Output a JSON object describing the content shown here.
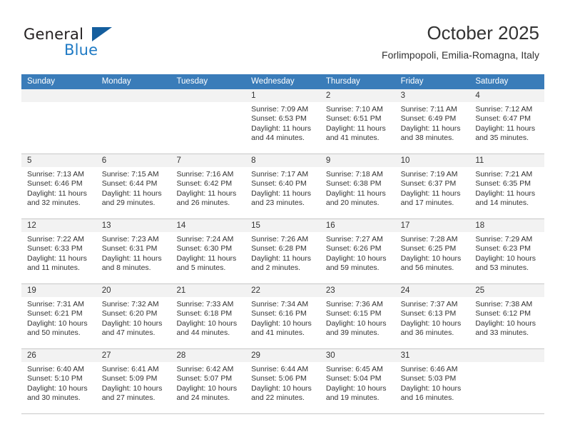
{
  "brand": {
    "name_top": "General",
    "name_bottom": "Blue",
    "triangle_color": "#145e9e",
    "blue_color": "#1f7ac4"
  },
  "header": {
    "title": "October 2025",
    "subtitle": "Forlimpopoli, Emilia-Romagna, Italy"
  },
  "theme": {
    "header_row_bg": "#3a7cb9",
    "header_row_text": "#ffffff",
    "day_number_strip_bg": "#f2f2f2",
    "grid_line": "#c8c8c8",
    "text": "#333333"
  },
  "weekdays": [
    "Sunday",
    "Monday",
    "Tuesday",
    "Wednesday",
    "Thursday",
    "Friday",
    "Saturday"
  ],
  "weeks": [
    [
      {
        "day": "",
        "sunrise": "",
        "sunset": "",
        "daylight_line1": "",
        "daylight_line2": ""
      },
      {
        "day": "",
        "sunrise": "",
        "sunset": "",
        "daylight_line1": "",
        "daylight_line2": ""
      },
      {
        "day": "",
        "sunrise": "",
        "sunset": "",
        "daylight_line1": "",
        "daylight_line2": ""
      },
      {
        "day": "1",
        "sunrise": "Sunrise: 7:09 AM",
        "sunset": "Sunset: 6:53 PM",
        "daylight_line1": "Daylight: 11 hours",
        "daylight_line2": "and 44 minutes."
      },
      {
        "day": "2",
        "sunrise": "Sunrise: 7:10 AM",
        "sunset": "Sunset: 6:51 PM",
        "daylight_line1": "Daylight: 11 hours",
        "daylight_line2": "and 41 minutes."
      },
      {
        "day": "3",
        "sunrise": "Sunrise: 7:11 AM",
        "sunset": "Sunset: 6:49 PM",
        "daylight_line1": "Daylight: 11 hours",
        "daylight_line2": "and 38 minutes."
      },
      {
        "day": "4",
        "sunrise": "Sunrise: 7:12 AM",
        "sunset": "Sunset: 6:47 PM",
        "daylight_line1": "Daylight: 11 hours",
        "daylight_line2": "and 35 minutes."
      }
    ],
    [
      {
        "day": "5",
        "sunrise": "Sunrise: 7:13 AM",
        "sunset": "Sunset: 6:46 PM",
        "daylight_line1": "Daylight: 11 hours",
        "daylight_line2": "and 32 minutes."
      },
      {
        "day": "6",
        "sunrise": "Sunrise: 7:15 AM",
        "sunset": "Sunset: 6:44 PM",
        "daylight_line1": "Daylight: 11 hours",
        "daylight_line2": "and 29 minutes."
      },
      {
        "day": "7",
        "sunrise": "Sunrise: 7:16 AM",
        "sunset": "Sunset: 6:42 PM",
        "daylight_line1": "Daylight: 11 hours",
        "daylight_line2": "and 26 minutes."
      },
      {
        "day": "8",
        "sunrise": "Sunrise: 7:17 AM",
        "sunset": "Sunset: 6:40 PM",
        "daylight_line1": "Daylight: 11 hours",
        "daylight_line2": "and 23 minutes."
      },
      {
        "day": "9",
        "sunrise": "Sunrise: 7:18 AM",
        "sunset": "Sunset: 6:38 PM",
        "daylight_line1": "Daylight: 11 hours",
        "daylight_line2": "and 20 minutes."
      },
      {
        "day": "10",
        "sunrise": "Sunrise: 7:19 AM",
        "sunset": "Sunset: 6:37 PM",
        "daylight_line1": "Daylight: 11 hours",
        "daylight_line2": "and 17 minutes."
      },
      {
        "day": "11",
        "sunrise": "Sunrise: 7:21 AM",
        "sunset": "Sunset: 6:35 PM",
        "daylight_line1": "Daylight: 11 hours",
        "daylight_line2": "and 14 minutes."
      }
    ],
    [
      {
        "day": "12",
        "sunrise": "Sunrise: 7:22 AM",
        "sunset": "Sunset: 6:33 PM",
        "daylight_line1": "Daylight: 11 hours",
        "daylight_line2": "and 11 minutes."
      },
      {
        "day": "13",
        "sunrise": "Sunrise: 7:23 AM",
        "sunset": "Sunset: 6:31 PM",
        "daylight_line1": "Daylight: 11 hours",
        "daylight_line2": "and 8 minutes."
      },
      {
        "day": "14",
        "sunrise": "Sunrise: 7:24 AM",
        "sunset": "Sunset: 6:30 PM",
        "daylight_line1": "Daylight: 11 hours",
        "daylight_line2": "and 5 minutes."
      },
      {
        "day": "15",
        "sunrise": "Sunrise: 7:26 AM",
        "sunset": "Sunset: 6:28 PM",
        "daylight_line1": "Daylight: 11 hours",
        "daylight_line2": "and 2 minutes."
      },
      {
        "day": "16",
        "sunrise": "Sunrise: 7:27 AM",
        "sunset": "Sunset: 6:26 PM",
        "daylight_line1": "Daylight: 10 hours",
        "daylight_line2": "and 59 minutes."
      },
      {
        "day": "17",
        "sunrise": "Sunrise: 7:28 AM",
        "sunset": "Sunset: 6:25 PM",
        "daylight_line1": "Daylight: 10 hours",
        "daylight_line2": "and 56 minutes."
      },
      {
        "day": "18",
        "sunrise": "Sunrise: 7:29 AM",
        "sunset": "Sunset: 6:23 PM",
        "daylight_line1": "Daylight: 10 hours",
        "daylight_line2": "and 53 minutes."
      }
    ],
    [
      {
        "day": "19",
        "sunrise": "Sunrise: 7:31 AM",
        "sunset": "Sunset: 6:21 PM",
        "daylight_line1": "Daylight: 10 hours",
        "daylight_line2": "and 50 minutes."
      },
      {
        "day": "20",
        "sunrise": "Sunrise: 7:32 AM",
        "sunset": "Sunset: 6:20 PM",
        "daylight_line1": "Daylight: 10 hours",
        "daylight_line2": "and 47 minutes."
      },
      {
        "day": "21",
        "sunrise": "Sunrise: 7:33 AM",
        "sunset": "Sunset: 6:18 PM",
        "daylight_line1": "Daylight: 10 hours",
        "daylight_line2": "and 44 minutes."
      },
      {
        "day": "22",
        "sunrise": "Sunrise: 7:34 AM",
        "sunset": "Sunset: 6:16 PM",
        "daylight_line1": "Daylight: 10 hours",
        "daylight_line2": "and 41 minutes."
      },
      {
        "day": "23",
        "sunrise": "Sunrise: 7:36 AM",
        "sunset": "Sunset: 6:15 PM",
        "daylight_line1": "Daylight: 10 hours",
        "daylight_line2": "and 39 minutes."
      },
      {
        "day": "24",
        "sunrise": "Sunrise: 7:37 AM",
        "sunset": "Sunset: 6:13 PM",
        "daylight_line1": "Daylight: 10 hours",
        "daylight_line2": "and 36 minutes."
      },
      {
        "day": "25",
        "sunrise": "Sunrise: 7:38 AM",
        "sunset": "Sunset: 6:12 PM",
        "daylight_line1": "Daylight: 10 hours",
        "daylight_line2": "and 33 minutes."
      }
    ],
    [
      {
        "day": "26",
        "sunrise": "Sunrise: 6:40 AM",
        "sunset": "Sunset: 5:10 PM",
        "daylight_line1": "Daylight: 10 hours",
        "daylight_line2": "and 30 minutes."
      },
      {
        "day": "27",
        "sunrise": "Sunrise: 6:41 AM",
        "sunset": "Sunset: 5:09 PM",
        "daylight_line1": "Daylight: 10 hours",
        "daylight_line2": "and 27 minutes."
      },
      {
        "day": "28",
        "sunrise": "Sunrise: 6:42 AM",
        "sunset": "Sunset: 5:07 PM",
        "daylight_line1": "Daylight: 10 hours",
        "daylight_line2": "and 24 minutes."
      },
      {
        "day": "29",
        "sunrise": "Sunrise: 6:44 AM",
        "sunset": "Sunset: 5:06 PM",
        "daylight_line1": "Daylight: 10 hours",
        "daylight_line2": "and 22 minutes."
      },
      {
        "day": "30",
        "sunrise": "Sunrise: 6:45 AM",
        "sunset": "Sunset: 5:04 PM",
        "daylight_line1": "Daylight: 10 hours",
        "daylight_line2": "and 19 minutes."
      },
      {
        "day": "31",
        "sunrise": "Sunrise: 6:46 AM",
        "sunset": "Sunset: 5:03 PM",
        "daylight_line1": "Daylight: 10 hours",
        "daylight_line2": "and 16 minutes."
      },
      {
        "day": "",
        "sunrise": "",
        "sunset": "",
        "daylight_line1": "",
        "daylight_line2": ""
      }
    ]
  ]
}
